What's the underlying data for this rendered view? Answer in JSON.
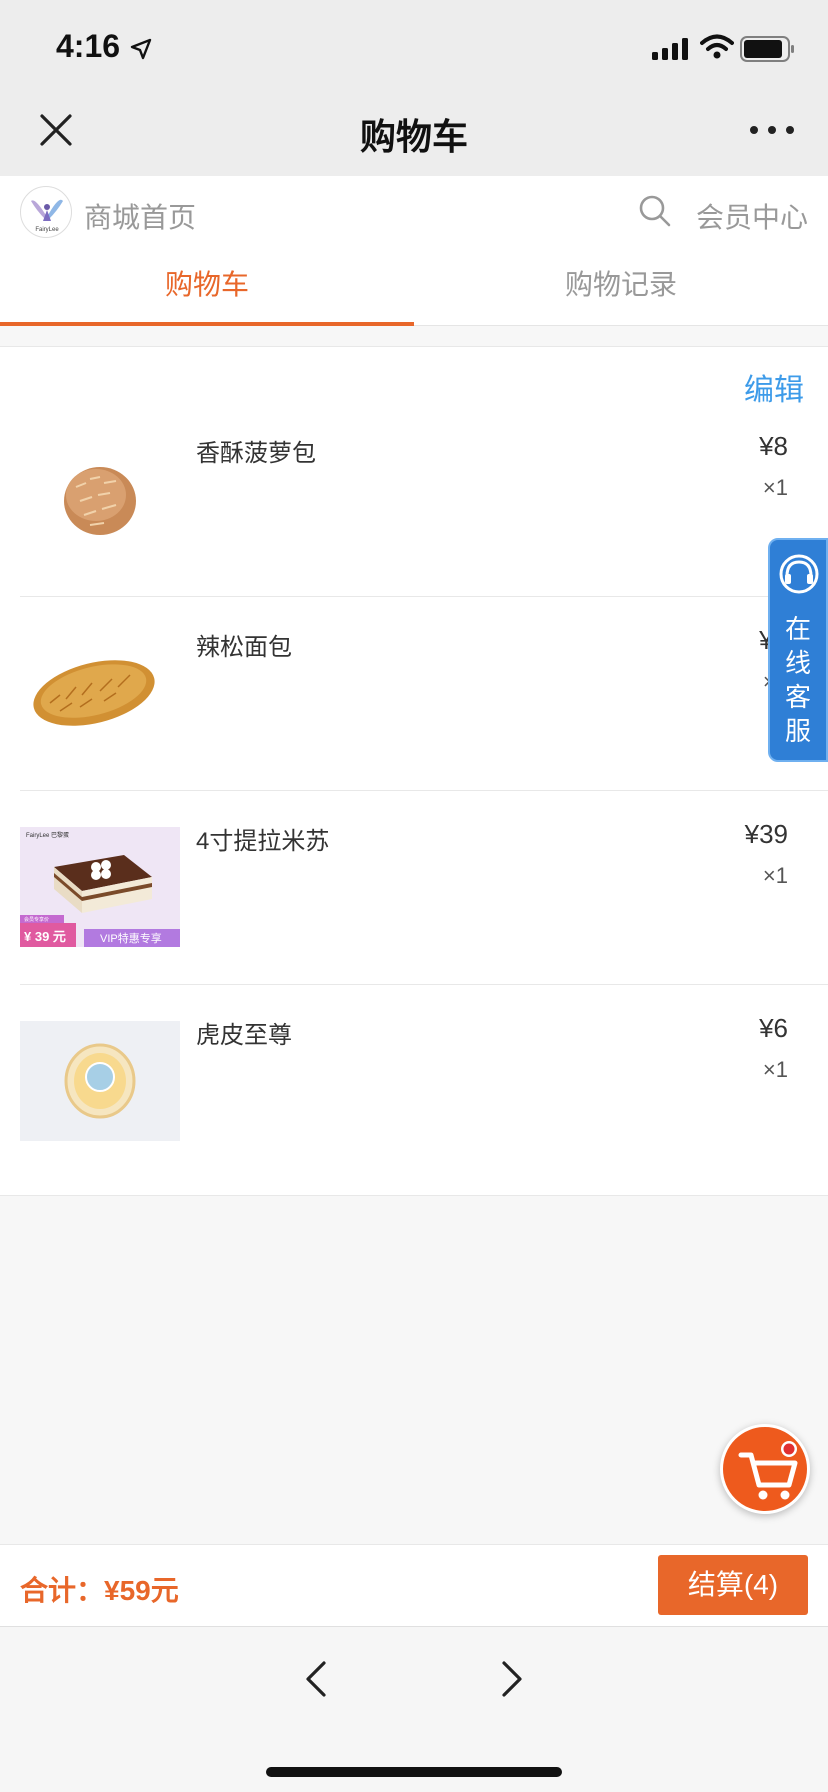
{
  "status_bar": {
    "time": "4:16"
  },
  "nav": {
    "title": "购物车"
  },
  "store": {
    "logo_text": "FairyLee",
    "home_label": "商城首页",
    "member_label": "会员中心"
  },
  "tabs": [
    {
      "label": "购物车",
      "active": true
    },
    {
      "label": "购物记录",
      "active": false
    }
  ],
  "cart": {
    "edit_label": "编辑",
    "items": [
      {
        "name": "香酥菠萝包",
        "price": "¥8",
        "qty": "×1"
      },
      {
        "name": "辣松面包",
        "price": "¥6",
        "qty": "×1"
      },
      {
        "name": "4寸提拉米苏",
        "price": "¥39",
        "qty": "×1",
        "thumb": {
          "brand": "FairyLee 巴黎蛋",
          "badge_top": "会员专享价",
          "price_tag": "¥ 39 元",
          "vip": "VIP特惠专享"
        }
      },
      {
        "name": "虎皮至尊",
        "price": "¥6",
        "qty": "×1"
      }
    ]
  },
  "service": {
    "label_lines": [
      "在",
      "线",
      "客",
      "服"
    ]
  },
  "footer": {
    "total": "合计：¥59元",
    "checkout": "结算(4)"
  },
  "colors": {
    "accent": "#e8672a",
    "link": "#3d9be9",
    "service": "#2f7fd6"
  }
}
